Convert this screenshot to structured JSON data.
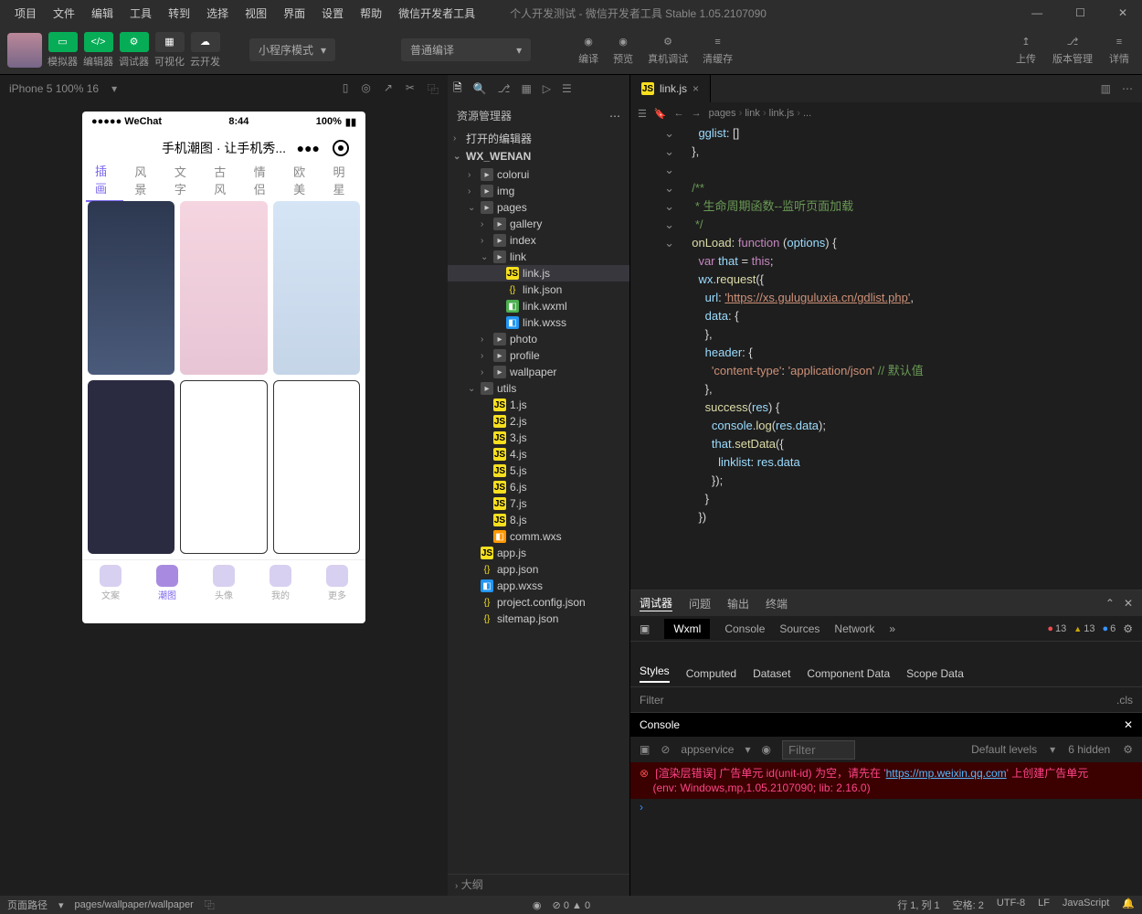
{
  "menu": [
    "项目",
    "文件",
    "编辑",
    "工具",
    "转到",
    "选择",
    "视图",
    "界面",
    "设置",
    "帮助",
    "微信开发者工具"
  ],
  "title": "个人开发测试 - 微信开发者工具 Stable 1.05.2107090",
  "toolbar": {
    "sim": "模拟器",
    "edit": "编辑器",
    "debug": "调试器",
    "vis": "可视化",
    "cloud": "云开发",
    "mode": "小程序模式",
    "compile_mode": "普通编译",
    "compile": "编译",
    "preview": "预览",
    "remote": "真机调试",
    "clear": "清缓存",
    "upload": "上传",
    "version": "版本管理",
    "detail": "详情"
  },
  "sim": {
    "device": "iPhone 5 100% 16"
  },
  "phone": {
    "carrier": "●●●●● WeChat",
    "wifi": "📶",
    "time": "8:44",
    "batt": "100%",
    "title": "手机潮图 · 让手机秀...",
    "tabs": [
      "插画",
      "风景",
      "文字",
      "古风",
      "情侣",
      "欧美",
      "明星"
    ],
    "nav": [
      "文案",
      "潮图",
      "头像",
      "我的",
      "更多"
    ]
  },
  "explorer": {
    "title": "资源管理器",
    "open_editors": "打开的编辑器",
    "proj": "WX_WENAN",
    "tree": [
      {
        "n": "colorui",
        "t": "folder",
        "d": 1
      },
      {
        "n": "img",
        "t": "folder",
        "d": 1,
        "i": "wxml"
      },
      {
        "n": "pages",
        "t": "folder",
        "d": 1,
        "open": true,
        "i": "wxs",
        "children": [
          {
            "n": "gallery",
            "t": "folder",
            "d": 2
          },
          {
            "n": "index",
            "t": "folder",
            "d": 2
          },
          {
            "n": "link",
            "t": "folder",
            "d": 2,
            "open": true,
            "children": [
              {
                "n": "link.js",
                "t": "js",
                "d": 3,
                "sel": true
              },
              {
                "n": "link.json",
                "t": "json",
                "d": 3
              },
              {
                "n": "link.wxml",
                "t": "wxml",
                "d": 3
              },
              {
                "n": "link.wxss",
                "t": "wxss",
                "d": 3
              }
            ]
          },
          {
            "n": "photo",
            "t": "folder",
            "d": 2
          },
          {
            "n": "profile",
            "t": "folder",
            "d": 2
          },
          {
            "n": "wallpaper",
            "t": "folder",
            "d": 2
          }
        ]
      },
      {
        "n": "utils",
        "t": "folder",
        "d": 1,
        "open": true,
        "i": "wxml",
        "children": [
          {
            "n": "1.js",
            "t": "js",
            "d": 2
          },
          {
            "n": "2.js",
            "t": "js",
            "d": 2
          },
          {
            "n": "3.js",
            "t": "js",
            "d": 2
          },
          {
            "n": "4.js",
            "t": "js",
            "d": 2
          },
          {
            "n": "5.js",
            "t": "js",
            "d": 2
          },
          {
            "n": "6.js",
            "t": "js",
            "d": 2
          },
          {
            "n": "7.js",
            "t": "js",
            "d": 2
          },
          {
            "n": "8.js",
            "t": "js",
            "d": 2
          },
          {
            "n": "comm.wxs",
            "t": "wxs",
            "d": 2
          }
        ]
      },
      {
        "n": "app.js",
        "t": "js",
        "d": 1
      },
      {
        "n": "app.json",
        "t": "json",
        "d": 1
      },
      {
        "n": "app.wxss",
        "t": "wxss",
        "d": 1
      },
      {
        "n": "project.config.json",
        "t": "json",
        "d": 1
      },
      {
        "n": "sitemap.json",
        "t": "json",
        "d": 1
      }
    ],
    "outline": "大纲"
  },
  "editor": {
    "tab": "link.js",
    "breadcrumb": [
      "pages",
      "link",
      "link.js",
      "..."
    ],
    "lines": [
      {
        "html": "    <span class='c-v'>gglist</span><span class='c-p'>: []</span>"
      },
      {
        "html": "  <span class='c-p'>},</span>"
      },
      {
        "html": ""
      },
      {
        "html": "  <span class='c-c'>/**</span>"
      },
      {
        "html": "  <span class='c-c'> * 生命周期函数--监听页面加载</span>"
      },
      {
        "html": "  <span class='c-c'> */</span>"
      },
      {
        "html": "  <span class='c-f'>onLoad</span><span class='c-p'>: </span><span class='c-k'>function</span> <span class='c-p'>(</span><span class='c-v'>options</span><span class='c-p'>) {</span>"
      },
      {
        "html": "    <span class='c-k'>var</span> <span class='c-v'>that</span> <span class='c-p'>=</span> <span class='c-k'>this</span><span class='c-p'>;</span>"
      },
      {
        "html": "    <span class='c-v'>wx</span><span class='c-p'>.</span><span class='c-f'>request</span><span class='c-p'>({</span>"
      },
      {
        "html": "      <span class='c-v'>url</span><span class='c-p'>: </span><span class='c-url'>'https://xs.guluguluxia.cn/gdlist.php'</span><span class='c-p'>,</span>"
      },
      {
        "html": "      <span class='c-v'>data</span><span class='c-p'>: {</span>"
      },
      {
        "html": "      <span class='c-p'>},</span>"
      },
      {
        "html": "      <span class='c-v'>header</span><span class='c-p'>: {</span>"
      },
      {
        "html": "        <span class='c-s'>'content-type'</span><span class='c-p'>: </span><span class='c-s'>'application/json'</span> <span class='c-c'>// 默认值</span>"
      },
      {
        "html": "      <span class='c-p'>},</span>"
      },
      {
        "html": "      <span class='c-f'>success</span><span class='c-p'>(</span><span class='c-v'>res</span><span class='c-p'>) {</span>"
      },
      {
        "html": "        <span class='c-v'>console</span><span class='c-p'>.</span><span class='c-f'>log</span><span class='c-p'>(</span><span class='c-v'>res</span><span class='c-p'>.</span><span class='c-v'>data</span><span class='c-p'>);</span>"
      },
      {
        "html": "        <span class='c-v'>that</span><span class='c-p'>.</span><span class='c-f'>setData</span><span class='c-p'>({</span>"
      },
      {
        "html": "          <span class='c-v'>linklist</span><span class='c-p'>: </span><span class='c-v'>res</span><span class='c-p'>.</span><span class='c-v'>data</span>"
      },
      {
        "html": "        <span class='c-p'>});</span>"
      },
      {
        "html": "      <span class='c-p'>}</span>"
      },
      {
        "html": "    <span class='c-p'>})</span>"
      }
    ]
  },
  "devtools": {
    "tabs": [
      "调试器",
      "问题",
      "输出",
      "终端"
    ],
    "tabs2": [
      "Wxml",
      "Console",
      "Sources",
      "Network"
    ],
    "badges": {
      "e": "13",
      "w": "13",
      "i": "6"
    },
    "styles": [
      "Styles",
      "Computed",
      "Dataset",
      "Component Data",
      "Scope Data"
    ],
    "filter": "Filter",
    "cls": ".cls",
    "console_title": "Console",
    "context": "appservice",
    "levels": "Default levels",
    "hidden": "6 hidden",
    "err1": "[渲染层错误] 广告单元 id(unit-id) 为空，请先在 '",
    "err_link": "https://mp.weixin.qq.com",
    "err1b": "' 上创建广告单元",
    "err2": "(env: Windows,mp,1.05.2107090; lib: 2.16.0)"
  },
  "status": {
    "path_label": "页面路径",
    "path": "pages/wallpaper/wallpaper",
    "warn": "0",
    "err": "0",
    "line": "行 1, 列 1",
    "space": "空格: 2",
    "enc": "UTF-8",
    "eol": "LF",
    "lang": "JavaScript"
  }
}
